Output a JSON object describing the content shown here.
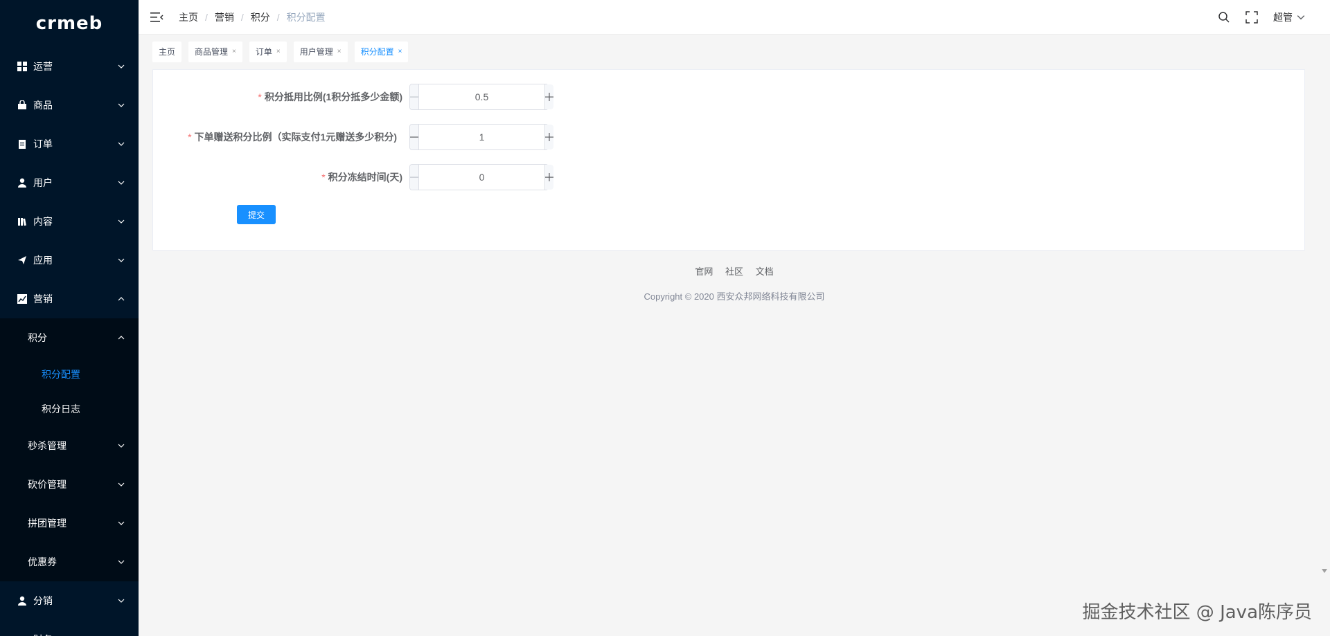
{
  "app": {
    "logo": "crmeb"
  },
  "sidebar": {
    "items": [
      {
        "label": "运营",
        "icon": "dashboard-icon"
      },
      {
        "label": "商品",
        "icon": "shopping-bag-icon"
      },
      {
        "label": "订单",
        "icon": "clipboard-icon"
      },
      {
        "label": "用户",
        "icon": "user-icon"
      },
      {
        "label": "内容",
        "icon": "book-icon"
      },
      {
        "label": "应用",
        "icon": "paper-plane-icon"
      },
      {
        "label": "营销",
        "icon": "chart-icon"
      }
    ],
    "marketing_sub": {
      "points": "积分",
      "points_config": "积分配置",
      "points_log": "积分日志",
      "seckill": "秒杀管理",
      "bargain": "砍价管理",
      "group": "拼团管理",
      "coupon": "优惠券"
    },
    "distribution": "分销",
    "finance_partial": "财务"
  },
  "header": {
    "breadcrumb": [
      "主页",
      "营销",
      "积分",
      "积分配置"
    ],
    "user": "超管"
  },
  "tags": [
    {
      "label": "主页",
      "closable": false
    },
    {
      "label": "商品管理",
      "closable": true
    },
    {
      "label": "订单",
      "closable": true
    },
    {
      "label": "用户管理",
      "closable": true
    },
    {
      "label": "积分配置",
      "closable": true,
      "active": true
    }
  ],
  "form": {
    "fields": [
      {
        "label": "积分抵用比例(1积分抵多少金额)",
        "value": "0.5"
      },
      {
        "label": "下单赠送积分比例（实际支付1元赠送多少积分)",
        "value": "1"
      },
      {
        "label": "积分冻结时间(天)",
        "value": "0"
      }
    ],
    "required_mark": "*",
    "submit_label": "提交"
  },
  "footer": {
    "links": [
      "官网",
      "社区",
      "文档"
    ],
    "copyright": "Copyright © 2020 西安众邦网络科技有限公司"
  },
  "watermark": "掘金技术社区 @ Java陈序员",
  "colors": {
    "sidebar_bg": "#001529",
    "primary": "#1890ff",
    "required": "#f56c6c"
  }
}
